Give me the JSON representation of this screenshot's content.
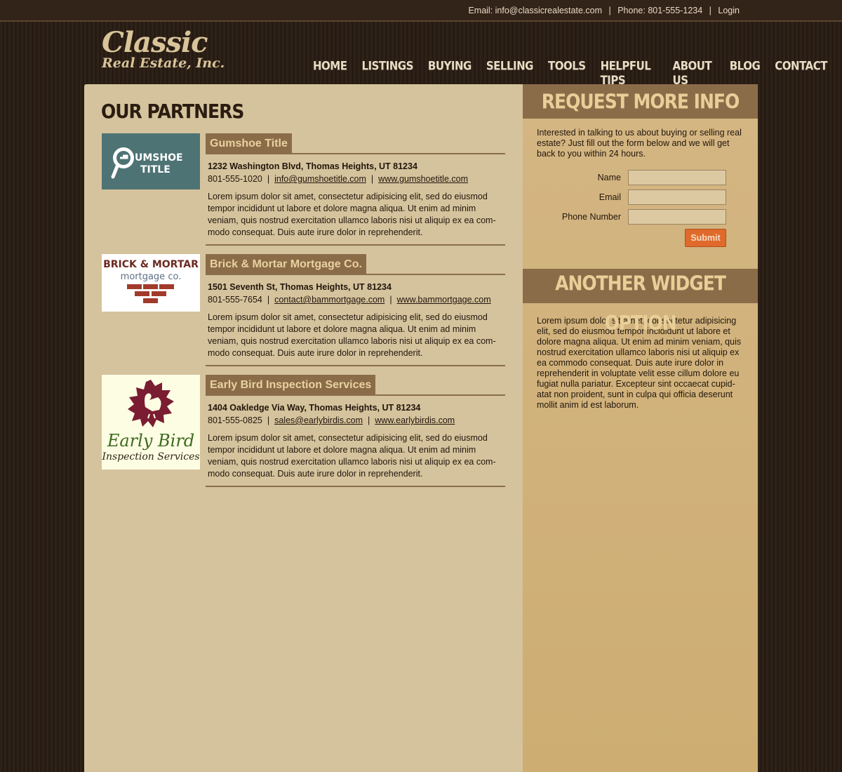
{
  "topbar": {
    "email_label": "Email:",
    "email": "info@classicrealestate.com",
    "phone_label": "Phone:",
    "phone": "801-555-1234",
    "login": "Login"
  },
  "logo": {
    "line1": "Classic",
    "line2": "Real Estate, Inc."
  },
  "nav": {
    "items": [
      "HOME",
      "LISTINGS",
      "BUYING",
      "SELLING",
      "TOOLS",
      "HELPFUL TIPS",
      "ABOUT US",
      "BLOG",
      "CONTACT"
    ]
  },
  "main": {
    "title": "OUR PARTNERS",
    "partners": [
      {
        "name": "Gumshoe Title",
        "logo_text": [
          "UMSHOE",
          "TITLE"
        ],
        "address": "1232 Washington Blvd, Thomas Heights, UT 81234",
        "phone": "801-555-1020",
        "email": "info@gumshoetitle.com",
        "website": "www.gumshoetitle.com",
        "description": "Lorem ipsum dolor sit amet, consectetur adipisicing elit, sed do eiusmod tempor incididunt ut labore et dolore magna aliqua. Ut enim ad minim veniam, quis nostrud exercitation ullamco laboris nisi ut aliquip ex ea com-modo consequat. Duis aute irure dolor in reprehenderit."
      },
      {
        "name": "Brick & Mortar Mortgage Co.",
        "logo_text": [
          "BRICK & MORTAR",
          "mortgage co."
        ],
        "address": "1501 Seventh St, Thomas Heights, UT 81234",
        "phone": "801-555-7654",
        "email": "contact@bammortgage.com",
        "website": "www.bammortgage.com",
        "description": "Lorem ipsum dolor sit amet, consectetur adipisicing elit, sed do eiusmod tempor incididunt ut labore et dolore magna aliqua. Ut enim ad minim veniam, quis nostrud exercitation ullamco laboris nisi ut aliquip ex ea com-modo consequat. Duis aute irure dolor in reprehenderit."
      },
      {
        "name": "Early Bird Inspection Services",
        "logo_text": [
          "Early Bird",
          "Inspection Services"
        ],
        "address": "1404 Oakledge Via Way, Thomas Heights, UT 81234",
        "phone": "801-555-0825",
        "email": "sales@earlybirdis.com",
        "website": "www.earlybirdis.com",
        "description": "Lorem ipsum dolor sit amet, consectetur adipisicing elit, sed do eiusmod tempor incididunt ut labore et dolore magna aliqua. Ut enim ad minim veniam, quis nostrud exercitation ullamco laboris nisi ut aliquip ex ea com-modo consequat. Duis aute irure dolor in reprehenderit."
      }
    ]
  },
  "sidebar": {
    "request": {
      "title": "REQUEST MORE INFO",
      "intro": "Interested in talking to us about buying or selling real estate? Just fill out the form below and we will get back to you within 24 hours.",
      "name_label": "Name",
      "email_label": "Email",
      "phone_label": "Phone Number",
      "name_value": "",
      "email_value": "",
      "phone_value": "",
      "submit": "Submit"
    },
    "widget": {
      "title": "ANOTHER WIDGET OPTION",
      "text": "Lorem ipsum dolor sit amet, consectetur adipisicing elit, sed do eiusmod tempor incididunt ut labore et dolore magna aliqua. Ut enim ad minim veniam, quis nostrud exercitation ullamco laboris nisi ut aliquip ex ea commodo consequat. Duis aute irure dolor in reprehenderit in voluptate velit esse cillum dolore eu fugiat nulla pariatur. Excepteur sint occaecat cupid-atat non proident, sunt in culpa qui officia deserunt mollit anim id est laborum."
    }
  },
  "colors": {
    "accent": "#8b6c49",
    "submit": "#e06a2b",
    "content_bg": "#d5c39d",
    "sidebar_bg": "#cdad72"
  }
}
